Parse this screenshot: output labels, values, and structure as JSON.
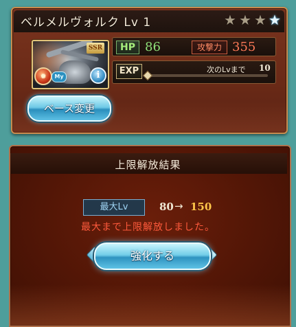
{
  "character": {
    "name": "ベルメルヴォルク",
    "level_text": "Lv 1",
    "rarity_badge": "SSR",
    "element_icon": "fire-icon",
    "my_badge": "My",
    "info_icon": "info-icon",
    "stars_total": 4,
    "stars_lit": 1
  },
  "stats": {
    "hp_label": "HP",
    "hp_value": "86",
    "atk_label": "攻撃力",
    "atk_value": "355",
    "exp_label": "EXP",
    "next_label": "次のLvまで",
    "next_value": "10",
    "exp_progress": 0.0
  },
  "buttons": {
    "base_change": "ベース変更",
    "enhance": "強化する"
  },
  "result": {
    "title": "上限解放結果",
    "max_lv_label": "最大Lv",
    "from_level": "80",
    "arrow": "→",
    "to_level": "150",
    "message": "最大まで上限解放しました。"
  },
  "colors": {
    "hp": "#8fe07a",
    "attack": "#ff7a58",
    "new_level": "#ffc64a",
    "message": "#ff5a3c",
    "button": "#5dc0e4"
  }
}
